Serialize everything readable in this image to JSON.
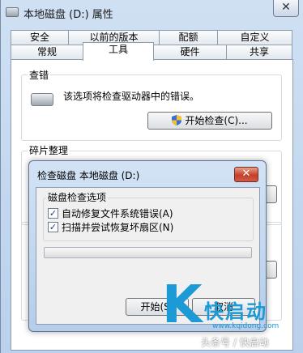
{
  "window": {
    "title": "本地磁盘 (D:) 属性",
    "close_label": "✕"
  },
  "tabs": {
    "row1": [
      "安全",
      "以前的版本",
      "配额",
      "自定义"
    ],
    "row2": [
      "常规",
      "工具",
      "硬件",
      "共享"
    ],
    "active": "工具"
  },
  "error_check": {
    "group_title": "查错",
    "description": "该选项将检查驱动器中的错误。",
    "button_label": "开始检查(C)..."
  },
  "defrag": {
    "group_title": "碎片整理"
  },
  "dialog": {
    "title": "检查磁盘 本地磁盘 (D:)",
    "close_label": "✕",
    "options_title": "磁盘检查选项",
    "option1": {
      "label": "自动修复文件系统错误(A)",
      "checked": true
    },
    "option2": {
      "label": "扫描并尝试恢复坏扇区(N)",
      "checked": true
    },
    "progress_percent": 0,
    "start_button": "开始(S)",
    "cancel_button": "取消"
  },
  "watermark": {
    "logo_letter": "K",
    "brand": "快启动",
    "url": "www.kqidong.com",
    "footer": "头条号 / 快启动"
  },
  "colors": {
    "accent": "#1c9ad6",
    "close_red": "#c4402a"
  }
}
